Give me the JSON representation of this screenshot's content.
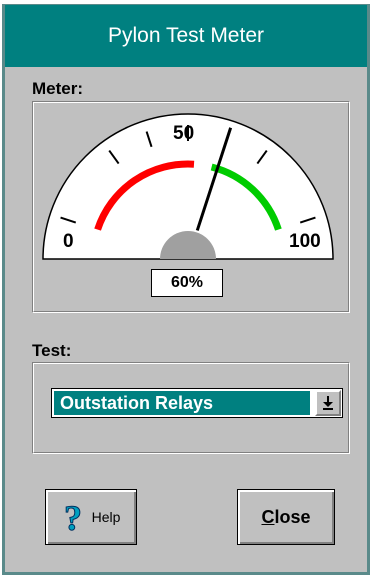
{
  "window": {
    "title": "Pylon Test Meter"
  },
  "meter": {
    "label": "Meter:",
    "scale_min": "0",
    "scale_mid": "50",
    "scale_max": "100",
    "value": 60,
    "readout": "60%",
    "colors": {
      "red_zone": "#ff0000",
      "green_zone": "#00cc00",
      "needle": "#000000",
      "hub": "#a0a0a0"
    }
  },
  "test": {
    "label": "Test:",
    "selected": "Outstation Relays",
    "arrow_glyph": "⭳"
  },
  "buttons": {
    "help_label": "Help",
    "help_icon_glyph": "?",
    "close_label_first": "C",
    "close_label_rest": "lose"
  },
  "colors": {
    "titlebar": "#008080",
    "face": "#c0c0c0"
  }
}
